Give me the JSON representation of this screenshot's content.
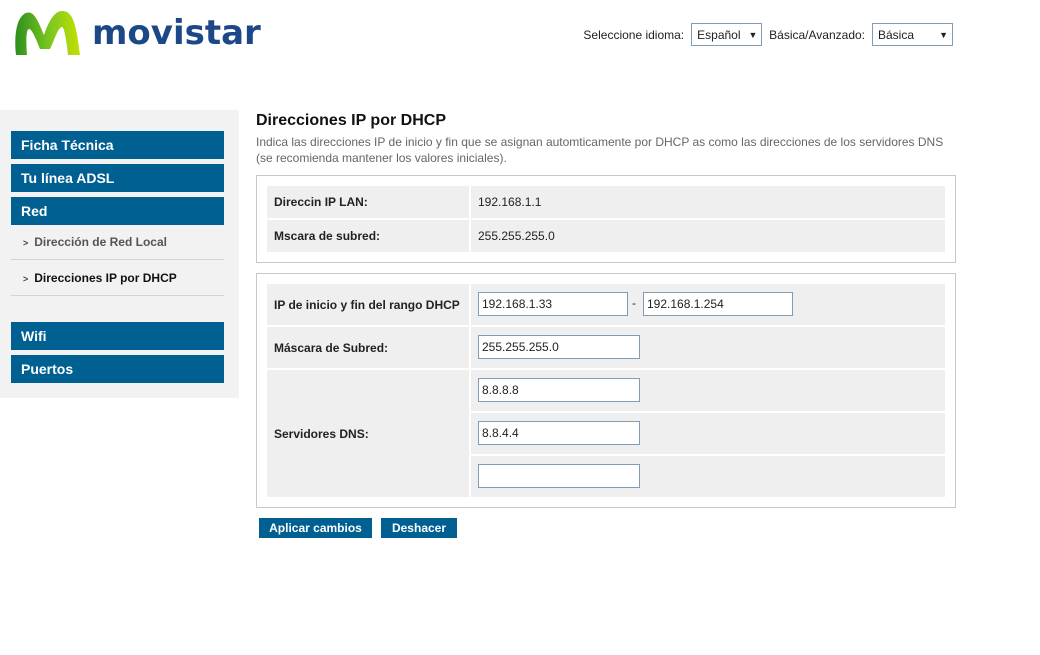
{
  "brand": {
    "name": "movistar",
    "color": "#1c4887",
    "logo_colors": [
      "#2e8f1e",
      "#7ec81f",
      "#c5e000"
    ]
  },
  "header": {
    "language_label": "Seleccione idioma:",
    "language_value": "Español",
    "mode_label": "Básica/Avanzado:",
    "mode_value": "Básica"
  },
  "sidebar": {
    "accent": "#006092",
    "items": [
      {
        "label": "Ficha Técnica"
      },
      {
        "label": "Tu línea ADSL"
      },
      {
        "label": "Red"
      },
      {
        "label": "Dirección de Red Local"
      },
      {
        "label": "Direcciones IP por DHCP"
      },
      {
        "label": "Wifi"
      },
      {
        "label": "Puertos"
      }
    ]
  },
  "main": {
    "title": "Direcciones IP por DHCP",
    "description": "Indica las direcciones IP de inicio y fin que se asignan automticamente por DHCP as como las direcciones de los servidores DNS (se recomienda mantener los valores iniciales).",
    "lan_info": {
      "ip_label": "Direccin IP LAN:",
      "ip_value": "192.168.1.1",
      "mask_label": "Mscara de subred:",
      "mask_value": "255.255.255.0"
    },
    "dhcp": {
      "range_label": "IP de inicio y fin del rango DHCP",
      "range_start": "192.168.1.33",
      "range_separator": "-",
      "range_end": "192.168.1.254",
      "mask_label": "Máscara de Subred:",
      "mask_value": "255.255.255.0",
      "dns_label": "Servidores DNS:",
      "dns1": "8.8.8.8",
      "dns2": "8.8.4.4",
      "dns3": ""
    },
    "buttons": {
      "apply": "Aplicar cambios",
      "undo": "Deshacer"
    }
  }
}
